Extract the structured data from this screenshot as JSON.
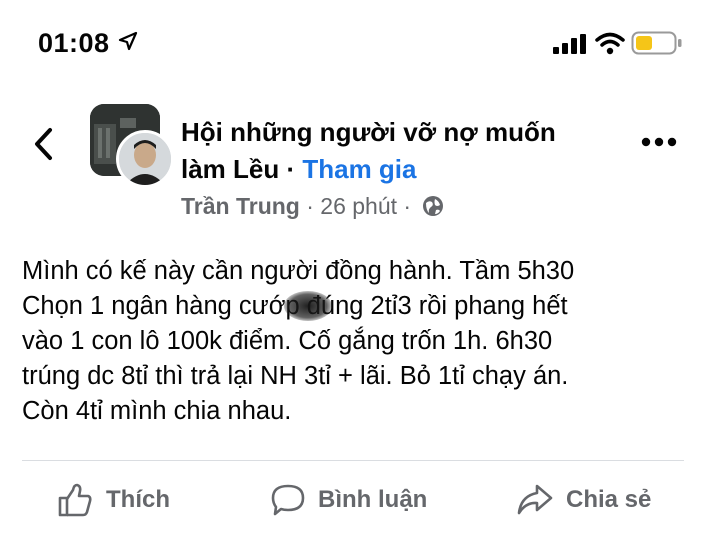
{
  "status_bar": {
    "time": "01:08",
    "icons": [
      "location-arrow-icon",
      "signal-icon",
      "wifi-icon",
      "battery-icon"
    ],
    "battery_color": "#f5c518"
  },
  "header": {
    "group_name": "Hội những người vỡ nợ muốn làm Lều",
    "separator": " · ",
    "join_label": "Tham gia",
    "author": "Trần Trung",
    "time_ago": "26 phút",
    "dot": " · ",
    "privacy_icon": "globe-icon",
    "accent_color": "#1b74e4"
  },
  "post": {
    "lines": [
      "Mình có kế này cần người đồng hành. Tầm 5h30",
      "Chọn 1 ngân hàng cướp đúng 2tỉ3 rồi phang hết",
      "vào 1 con lô 100k điểm. Cố gắng trốn 1h. 6h30",
      "trúng dc 8tỉ thì trả lại NH 3tỉ + lãi. Bỏ 1tỉ chạy án.",
      "Còn 4tỉ mình chia nhau."
    ]
  },
  "actions": {
    "like": "Thích",
    "comment": "Bình luận",
    "share": "Chia sẻ"
  }
}
